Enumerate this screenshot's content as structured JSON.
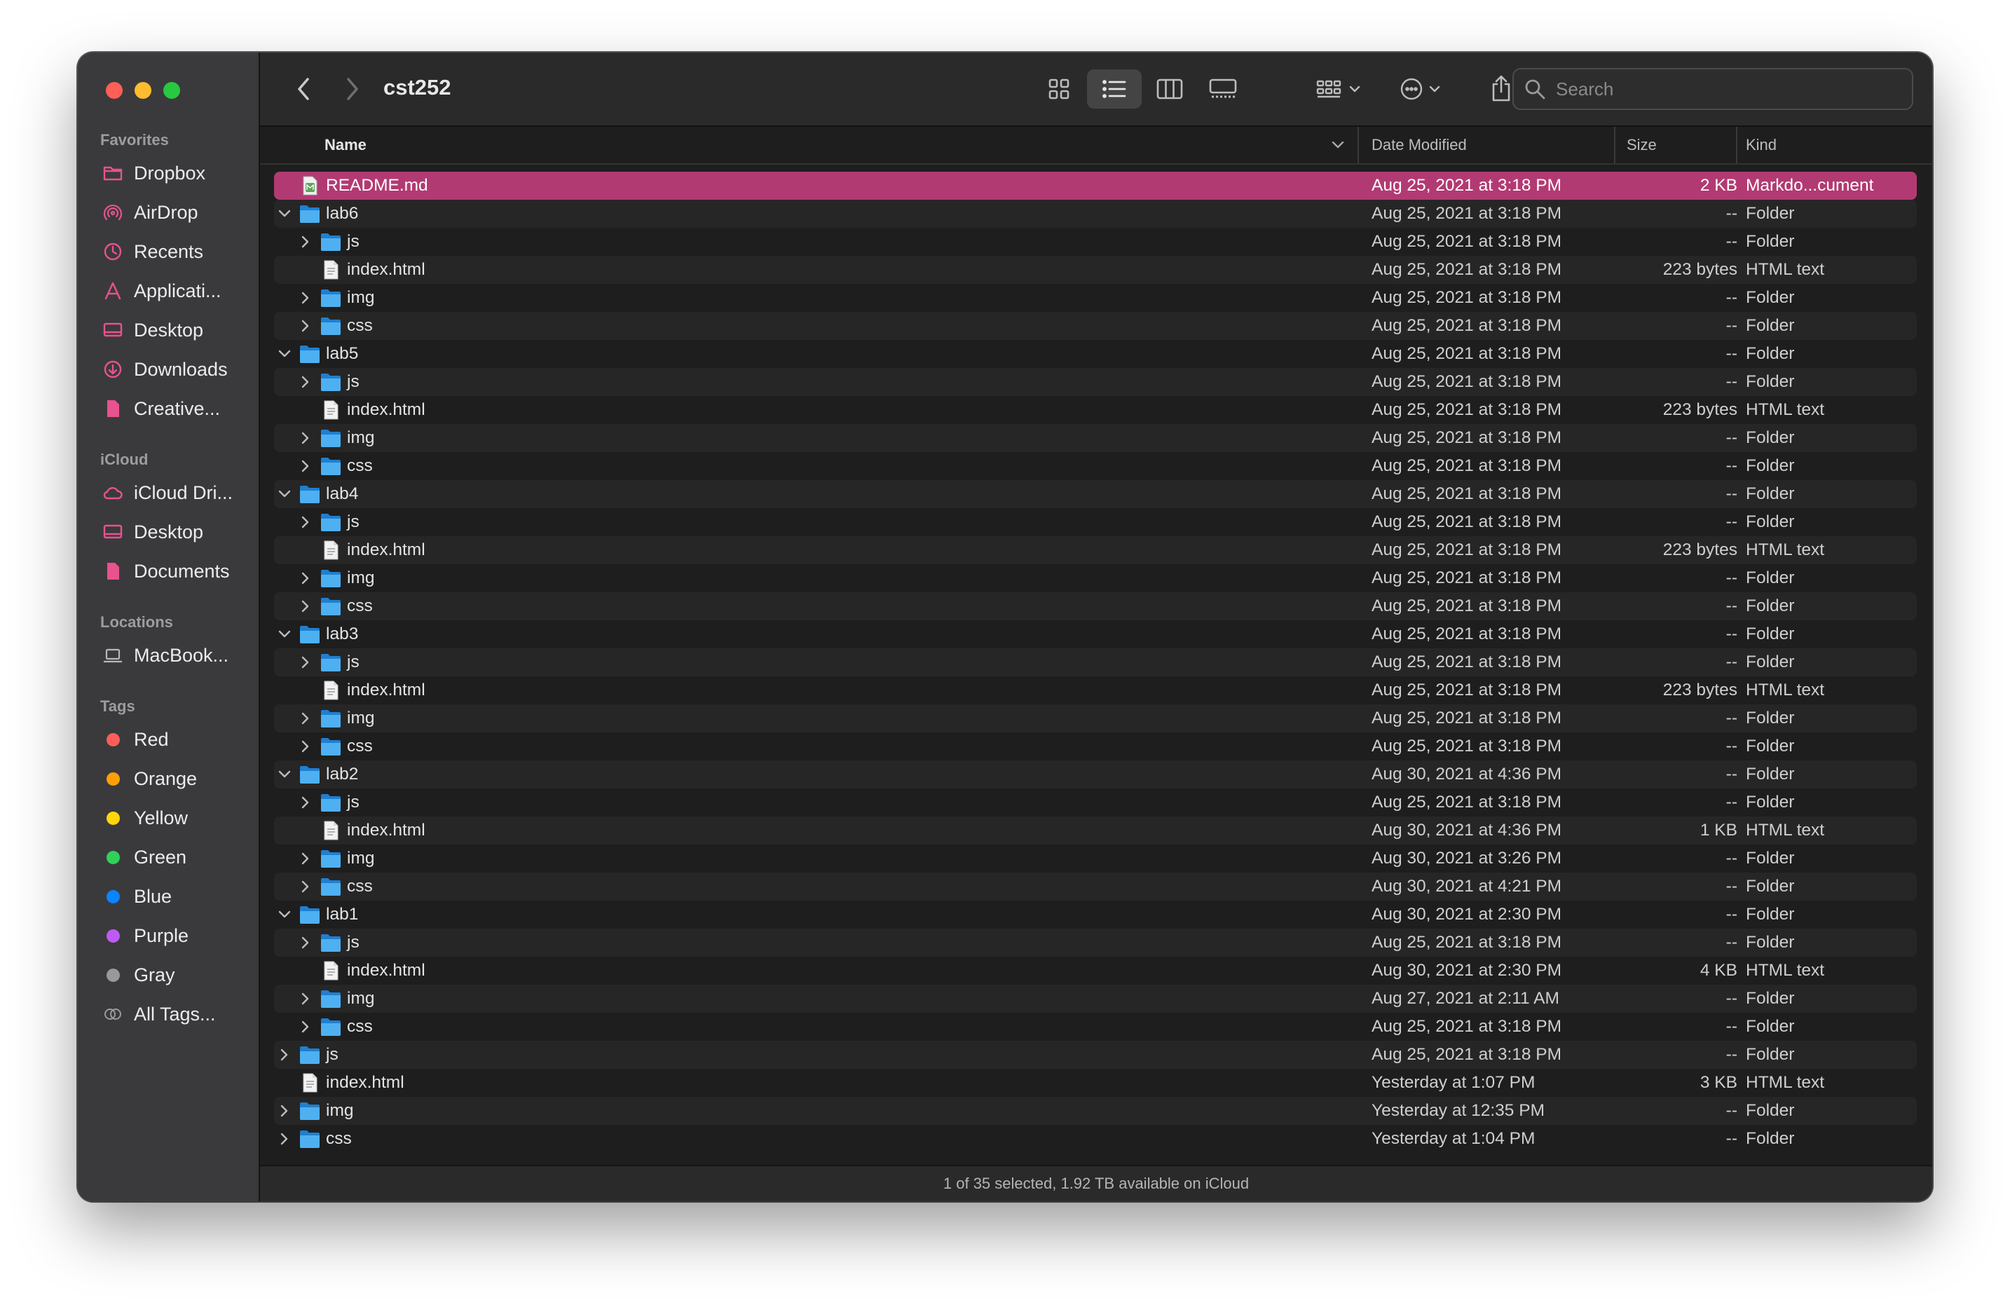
{
  "window": {
    "title": "cst252"
  },
  "sidebar": {
    "favorites_label": "Favorites",
    "favorites": [
      {
        "label": "Dropbox",
        "icon": "folder-icon"
      },
      {
        "label": "AirDrop",
        "icon": "airdrop-icon"
      },
      {
        "label": "Recents",
        "icon": "clock-icon"
      },
      {
        "label": "Applicati...",
        "icon": "applications-icon"
      },
      {
        "label": "Desktop",
        "icon": "desktop-icon"
      },
      {
        "label": "Downloads",
        "icon": "download-icon"
      },
      {
        "label": "Creative...",
        "icon": "document-icon"
      }
    ],
    "icloud_label": "iCloud",
    "icloud": [
      {
        "label": "iCloud Dri...",
        "icon": "cloud-icon"
      },
      {
        "label": "Desktop",
        "icon": "desktop-icon"
      },
      {
        "label": "Documents",
        "icon": "document-icon"
      }
    ],
    "locations_label": "Locations",
    "locations": [
      {
        "label": "MacBook...",
        "icon": "laptop-icon"
      }
    ],
    "tags_label": "Tags",
    "tags": [
      {
        "label": "Red",
        "color": "#fe5e5a"
      },
      {
        "label": "Orange",
        "color": "#fe9f0a"
      },
      {
        "label": "Yellow",
        "color": "#ffd60a"
      },
      {
        "label": "Green",
        "color": "#30d158"
      },
      {
        "label": "Blue",
        "color": "#0a84ff"
      },
      {
        "label": "Purple",
        "color": "#bf5af2"
      },
      {
        "label": "Gray",
        "color": "#98989d"
      },
      {
        "label": "All Tags...",
        "color": ""
      }
    ]
  },
  "toolbar": {
    "search_placeholder": "Search"
  },
  "columns": {
    "name": "Name",
    "date": "Date Modified",
    "size": "Size",
    "kind": "Kind"
  },
  "files": [
    {
      "name": "README.md",
      "date": "Aug 25, 2021 at 3:18 PM",
      "size": "2 KB",
      "kind": "Markdo...cument",
      "type": "md",
      "depth": 0,
      "selected": true
    },
    {
      "name": "lab6",
      "date": "Aug 25, 2021 at 3:18 PM",
      "size": "--",
      "kind": "Folder",
      "type": "folder",
      "depth": 0,
      "expanded": true
    },
    {
      "name": "js",
      "date": "Aug 25, 2021 at 3:18 PM",
      "size": "--",
      "kind": "Folder",
      "type": "folder",
      "depth": 1
    },
    {
      "name": "index.html",
      "date": "Aug 25, 2021 at 3:18 PM",
      "size": "223 bytes",
      "kind": "HTML text",
      "type": "file",
      "depth": 1
    },
    {
      "name": "img",
      "date": "Aug 25, 2021 at 3:18 PM",
      "size": "--",
      "kind": "Folder",
      "type": "folder",
      "depth": 1
    },
    {
      "name": "css",
      "date": "Aug 25, 2021 at 3:18 PM",
      "size": "--",
      "kind": "Folder",
      "type": "folder",
      "depth": 1
    },
    {
      "name": "lab5",
      "date": "Aug 25, 2021 at 3:18 PM",
      "size": "--",
      "kind": "Folder",
      "type": "folder",
      "depth": 0,
      "expanded": true
    },
    {
      "name": "js",
      "date": "Aug 25, 2021 at 3:18 PM",
      "size": "--",
      "kind": "Folder",
      "type": "folder",
      "depth": 1
    },
    {
      "name": "index.html",
      "date": "Aug 25, 2021 at 3:18 PM",
      "size": "223 bytes",
      "kind": "HTML text",
      "type": "file",
      "depth": 1
    },
    {
      "name": "img",
      "date": "Aug 25, 2021 at 3:18 PM",
      "size": "--",
      "kind": "Folder",
      "type": "folder",
      "depth": 1
    },
    {
      "name": "css",
      "date": "Aug 25, 2021 at 3:18 PM",
      "size": "--",
      "kind": "Folder",
      "type": "folder",
      "depth": 1
    },
    {
      "name": "lab4",
      "date": "Aug 25, 2021 at 3:18 PM",
      "size": "--",
      "kind": "Folder",
      "type": "folder",
      "depth": 0,
      "expanded": true
    },
    {
      "name": "js",
      "date": "Aug 25, 2021 at 3:18 PM",
      "size": "--",
      "kind": "Folder",
      "type": "folder",
      "depth": 1
    },
    {
      "name": "index.html",
      "date": "Aug 25, 2021 at 3:18 PM",
      "size": "223 bytes",
      "kind": "HTML text",
      "type": "file",
      "depth": 1
    },
    {
      "name": "img",
      "date": "Aug 25, 2021 at 3:18 PM",
      "size": "--",
      "kind": "Folder",
      "type": "folder",
      "depth": 1
    },
    {
      "name": "css",
      "date": "Aug 25, 2021 at 3:18 PM",
      "size": "--",
      "kind": "Folder",
      "type": "folder",
      "depth": 1
    },
    {
      "name": "lab3",
      "date": "Aug 25, 2021 at 3:18 PM",
      "size": "--",
      "kind": "Folder",
      "type": "folder",
      "depth": 0,
      "expanded": true
    },
    {
      "name": "js",
      "date": "Aug 25, 2021 at 3:18 PM",
      "size": "--",
      "kind": "Folder",
      "type": "folder",
      "depth": 1
    },
    {
      "name": "index.html",
      "date": "Aug 25, 2021 at 3:18 PM",
      "size": "223 bytes",
      "kind": "HTML text",
      "type": "file",
      "depth": 1
    },
    {
      "name": "img",
      "date": "Aug 25, 2021 at 3:18 PM",
      "size": "--",
      "kind": "Folder",
      "type": "folder",
      "depth": 1
    },
    {
      "name": "css",
      "date": "Aug 25, 2021 at 3:18 PM",
      "size": "--",
      "kind": "Folder",
      "type": "folder",
      "depth": 1
    },
    {
      "name": "lab2",
      "date": "Aug 30, 2021 at 4:36 PM",
      "size": "--",
      "kind": "Folder",
      "type": "folder",
      "depth": 0,
      "expanded": true
    },
    {
      "name": "js",
      "date": "Aug 25, 2021 at 3:18 PM",
      "size": "--",
      "kind": "Folder",
      "type": "folder",
      "depth": 1
    },
    {
      "name": "index.html",
      "date": "Aug 30, 2021 at 4:36 PM",
      "size": "1 KB",
      "kind": "HTML text",
      "type": "file",
      "depth": 1
    },
    {
      "name": "img",
      "date": "Aug 30, 2021 at 3:26 PM",
      "size": "--",
      "kind": "Folder",
      "type": "folder",
      "depth": 1
    },
    {
      "name": "css",
      "date": "Aug 30, 2021 at 4:21 PM",
      "size": "--",
      "kind": "Folder",
      "type": "folder",
      "depth": 1
    },
    {
      "name": "lab1",
      "date": "Aug 30, 2021 at 2:30 PM",
      "size": "--",
      "kind": "Folder",
      "type": "folder",
      "depth": 0,
      "expanded": true
    },
    {
      "name": "js",
      "date": "Aug 25, 2021 at 3:18 PM",
      "size": "--",
      "kind": "Folder",
      "type": "folder",
      "depth": 1
    },
    {
      "name": "index.html",
      "date": "Aug 30, 2021 at 2:30 PM",
      "size": "4 KB",
      "kind": "HTML text",
      "type": "file",
      "depth": 1
    },
    {
      "name": "img",
      "date": "Aug 27, 2021 at 2:11 AM",
      "size": "--",
      "kind": "Folder",
      "type": "folder",
      "depth": 1
    },
    {
      "name": "css",
      "date": "Aug 25, 2021 at 3:18 PM",
      "size": "--",
      "kind": "Folder",
      "type": "folder",
      "depth": 1
    },
    {
      "name": "js",
      "date": "Aug 25, 2021 at 3:18 PM",
      "size": "--",
      "kind": "Folder",
      "type": "folder",
      "depth": 0
    },
    {
      "name": "index.html",
      "date": "Yesterday at 1:07 PM",
      "size": "3 KB",
      "kind": "HTML text",
      "type": "file",
      "depth": 0
    },
    {
      "name": "img",
      "date": "Yesterday at 12:35 PM",
      "size": "--",
      "kind": "Folder",
      "type": "folder",
      "depth": 0
    },
    {
      "name": "css",
      "date": "Yesterday at 1:04 PM",
      "size": "--",
      "kind": "Folder",
      "type": "folder",
      "depth": 0
    }
  ],
  "status": "1 of 35 selected, 1.92 TB available on iCloud"
}
